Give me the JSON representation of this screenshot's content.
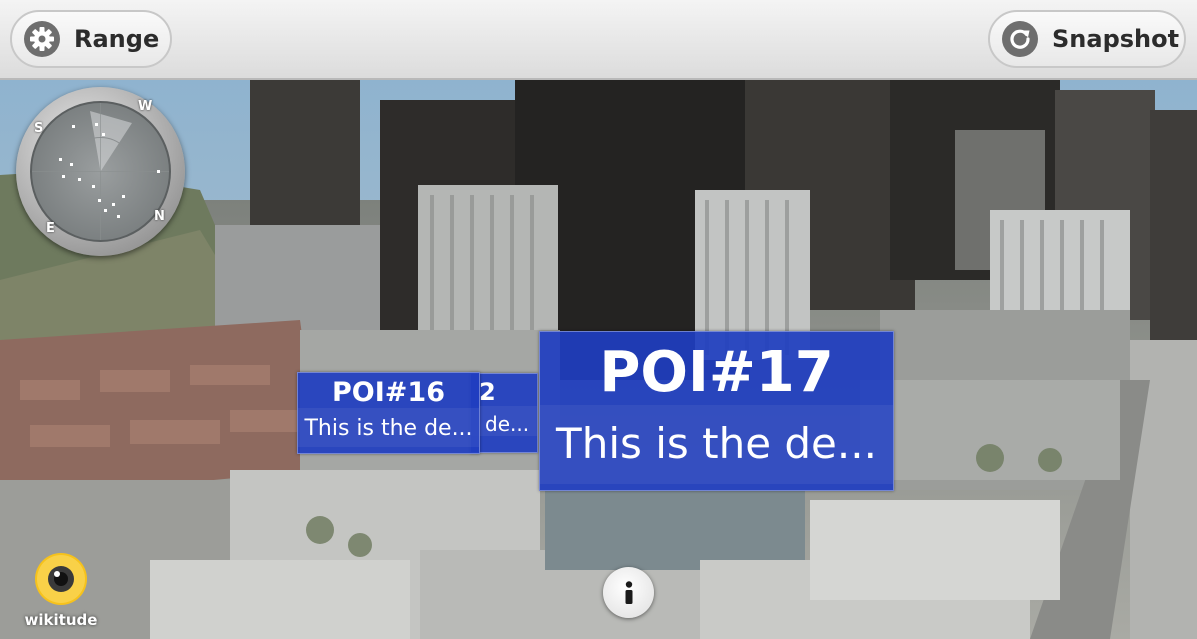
{
  "toolbar": {
    "range_label": "Range",
    "snapshot_label": "Snapshot"
  },
  "radar": {
    "directions": {
      "north": "N",
      "south": "S",
      "east": "E",
      "west": "W"
    }
  },
  "pois": [
    {
      "title": "POI#17",
      "description": "This is the de..."
    },
    {
      "title": "POI#16",
      "description": "This is the de..."
    },
    {
      "title": "2",
      "description": "de..."
    }
  ],
  "logo": {
    "text": "wikitude"
  },
  "colors": {
    "poi_blue": "#203ec0",
    "logo_yellow": "#f6c21c",
    "toolbar_bg": "#e8e8e8"
  },
  "icons": {
    "range": "gear-icon",
    "snapshot": "refresh-icon",
    "info": "info-icon"
  }
}
